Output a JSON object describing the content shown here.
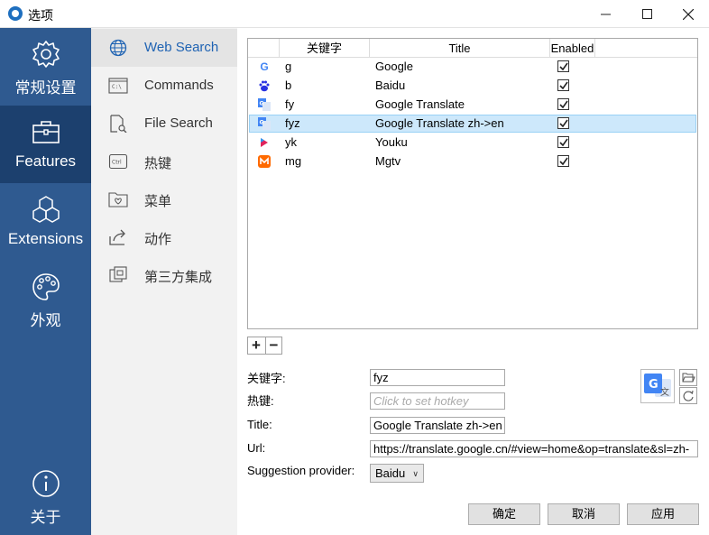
{
  "window": {
    "title": "选项"
  },
  "rail": {
    "items": [
      {
        "label": "常规设置",
        "icon": "gear-icon"
      },
      {
        "label": "Features",
        "icon": "toolbox-icon",
        "active": true
      },
      {
        "label": "Extensions",
        "icon": "cubes-icon"
      },
      {
        "label": "外观",
        "icon": "palette-icon"
      },
      {
        "label": "关于",
        "icon": "info-icon"
      }
    ]
  },
  "subnav": {
    "items": [
      {
        "label": "Web Search",
        "icon": "globe-icon",
        "active": true
      },
      {
        "label": "Commands",
        "icon": "terminal-icon"
      },
      {
        "label": "File Search",
        "icon": "file-search-icon"
      },
      {
        "label": "热键",
        "icon": "ctrl-key-icon"
      },
      {
        "label": "菜单",
        "icon": "menu-folder-icon"
      },
      {
        "label": "动作",
        "icon": "share-arrow-icon"
      },
      {
        "label": "第三方集成",
        "icon": "plugin-icon"
      }
    ]
  },
  "table": {
    "headers": {
      "keyword": "关键字",
      "title": "Title",
      "enabled": "Enabled"
    },
    "rows": [
      {
        "keyword": "g",
        "title": "Google",
        "enabled": true,
        "icon": "google-icon",
        "color": "#4285f4"
      },
      {
        "keyword": "b",
        "title": "Baidu",
        "enabled": true,
        "icon": "baidu-paw-icon",
        "color": "#2932e1"
      },
      {
        "keyword": "fy",
        "title": "Google Translate",
        "enabled": true,
        "icon": "google-translate-icon",
        "color": "#4285f4"
      },
      {
        "keyword": "fyz",
        "title": "Google Translate zh->en",
        "enabled": true,
        "icon": "google-translate-icon",
        "color": "#4285f4",
        "selected": true
      },
      {
        "keyword": "yk",
        "title": "Youku",
        "enabled": true,
        "icon": "youku-icon",
        "color": "#e1235b"
      },
      {
        "keyword": "mg",
        "title": "Mgtv",
        "enabled": true,
        "icon": "mgtv-icon",
        "color": "#ff6a00"
      }
    ]
  },
  "editor": {
    "add_label": "+",
    "remove_label": "−",
    "keyword_label": "关键字:",
    "keyword_value": "fyz",
    "hotkey_label": "热键:",
    "hotkey_placeholder": "Click to set hotkey",
    "title_label": "Title:",
    "title_value": "Google Translate zh->en",
    "url_label": "Url:",
    "url_value": "https://translate.google.cn/#view=home&op=translate&sl=zh-",
    "suggestion_label": "Suggestion provider:",
    "suggestion_value": "Baidu"
  },
  "buttons": {
    "ok": "确定",
    "cancel": "取消",
    "apply": "应用"
  },
  "colors": {
    "rail_bg": "#2f5a90",
    "rail_active": "#1c406e",
    "accent": "#1f63b3",
    "selection": "#cde8fb"
  }
}
